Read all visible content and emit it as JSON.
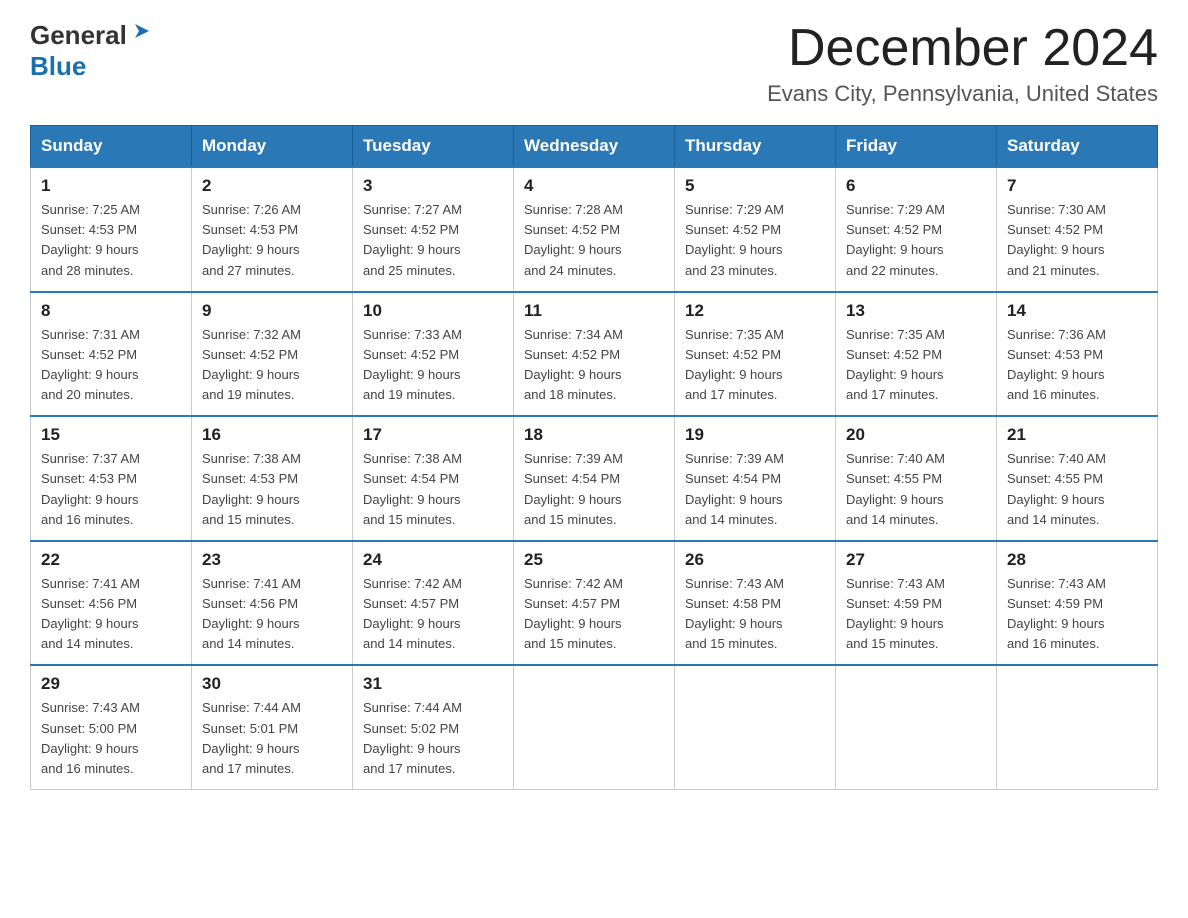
{
  "logo": {
    "general": "General",
    "blue": "Blue"
  },
  "title": "December 2024",
  "subtitle": "Evans City, Pennsylvania, United States",
  "weekdays": [
    "Sunday",
    "Monday",
    "Tuesday",
    "Wednesday",
    "Thursday",
    "Friday",
    "Saturday"
  ],
  "weeks": [
    [
      {
        "day": "1",
        "sunrise": "7:25 AM",
        "sunset": "4:53 PM",
        "daylight": "9 hours and 28 minutes."
      },
      {
        "day": "2",
        "sunrise": "7:26 AM",
        "sunset": "4:53 PM",
        "daylight": "9 hours and 27 minutes."
      },
      {
        "day": "3",
        "sunrise": "7:27 AM",
        "sunset": "4:52 PM",
        "daylight": "9 hours and 25 minutes."
      },
      {
        "day": "4",
        "sunrise": "7:28 AM",
        "sunset": "4:52 PM",
        "daylight": "9 hours and 24 minutes."
      },
      {
        "day": "5",
        "sunrise": "7:29 AM",
        "sunset": "4:52 PM",
        "daylight": "9 hours and 23 minutes."
      },
      {
        "day": "6",
        "sunrise": "7:29 AM",
        "sunset": "4:52 PM",
        "daylight": "9 hours and 22 minutes."
      },
      {
        "day": "7",
        "sunrise": "7:30 AM",
        "sunset": "4:52 PM",
        "daylight": "9 hours and 21 minutes."
      }
    ],
    [
      {
        "day": "8",
        "sunrise": "7:31 AM",
        "sunset": "4:52 PM",
        "daylight": "9 hours and 20 minutes."
      },
      {
        "day": "9",
        "sunrise": "7:32 AM",
        "sunset": "4:52 PM",
        "daylight": "9 hours and 19 minutes."
      },
      {
        "day": "10",
        "sunrise": "7:33 AM",
        "sunset": "4:52 PM",
        "daylight": "9 hours and 19 minutes."
      },
      {
        "day": "11",
        "sunrise": "7:34 AM",
        "sunset": "4:52 PM",
        "daylight": "9 hours and 18 minutes."
      },
      {
        "day": "12",
        "sunrise": "7:35 AM",
        "sunset": "4:52 PM",
        "daylight": "9 hours and 17 minutes."
      },
      {
        "day": "13",
        "sunrise": "7:35 AM",
        "sunset": "4:52 PM",
        "daylight": "9 hours and 17 minutes."
      },
      {
        "day": "14",
        "sunrise": "7:36 AM",
        "sunset": "4:53 PM",
        "daylight": "9 hours and 16 minutes."
      }
    ],
    [
      {
        "day": "15",
        "sunrise": "7:37 AM",
        "sunset": "4:53 PM",
        "daylight": "9 hours and 16 minutes."
      },
      {
        "day": "16",
        "sunrise": "7:38 AM",
        "sunset": "4:53 PM",
        "daylight": "9 hours and 15 minutes."
      },
      {
        "day": "17",
        "sunrise": "7:38 AM",
        "sunset": "4:54 PM",
        "daylight": "9 hours and 15 minutes."
      },
      {
        "day": "18",
        "sunrise": "7:39 AM",
        "sunset": "4:54 PM",
        "daylight": "9 hours and 15 minutes."
      },
      {
        "day": "19",
        "sunrise": "7:39 AM",
        "sunset": "4:54 PM",
        "daylight": "9 hours and 14 minutes."
      },
      {
        "day": "20",
        "sunrise": "7:40 AM",
        "sunset": "4:55 PM",
        "daylight": "9 hours and 14 minutes."
      },
      {
        "day": "21",
        "sunrise": "7:40 AM",
        "sunset": "4:55 PM",
        "daylight": "9 hours and 14 minutes."
      }
    ],
    [
      {
        "day": "22",
        "sunrise": "7:41 AM",
        "sunset": "4:56 PM",
        "daylight": "9 hours and 14 minutes."
      },
      {
        "day": "23",
        "sunrise": "7:41 AM",
        "sunset": "4:56 PM",
        "daylight": "9 hours and 14 minutes."
      },
      {
        "day": "24",
        "sunrise": "7:42 AM",
        "sunset": "4:57 PM",
        "daylight": "9 hours and 14 minutes."
      },
      {
        "day": "25",
        "sunrise": "7:42 AM",
        "sunset": "4:57 PM",
        "daylight": "9 hours and 15 minutes."
      },
      {
        "day": "26",
        "sunrise": "7:43 AM",
        "sunset": "4:58 PM",
        "daylight": "9 hours and 15 minutes."
      },
      {
        "day": "27",
        "sunrise": "7:43 AM",
        "sunset": "4:59 PM",
        "daylight": "9 hours and 15 minutes."
      },
      {
        "day": "28",
        "sunrise": "7:43 AM",
        "sunset": "4:59 PM",
        "daylight": "9 hours and 16 minutes."
      }
    ],
    [
      {
        "day": "29",
        "sunrise": "7:43 AM",
        "sunset": "5:00 PM",
        "daylight": "9 hours and 16 minutes."
      },
      {
        "day": "30",
        "sunrise": "7:44 AM",
        "sunset": "5:01 PM",
        "daylight": "9 hours and 17 minutes."
      },
      {
        "day": "31",
        "sunrise": "7:44 AM",
        "sunset": "5:02 PM",
        "daylight": "9 hours and 17 minutes."
      },
      null,
      null,
      null,
      null
    ]
  ],
  "labels": {
    "sunrise": "Sunrise: ",
    "sunset": "Sunset: ",
    "daylight": "Daylight: "
  }
}
